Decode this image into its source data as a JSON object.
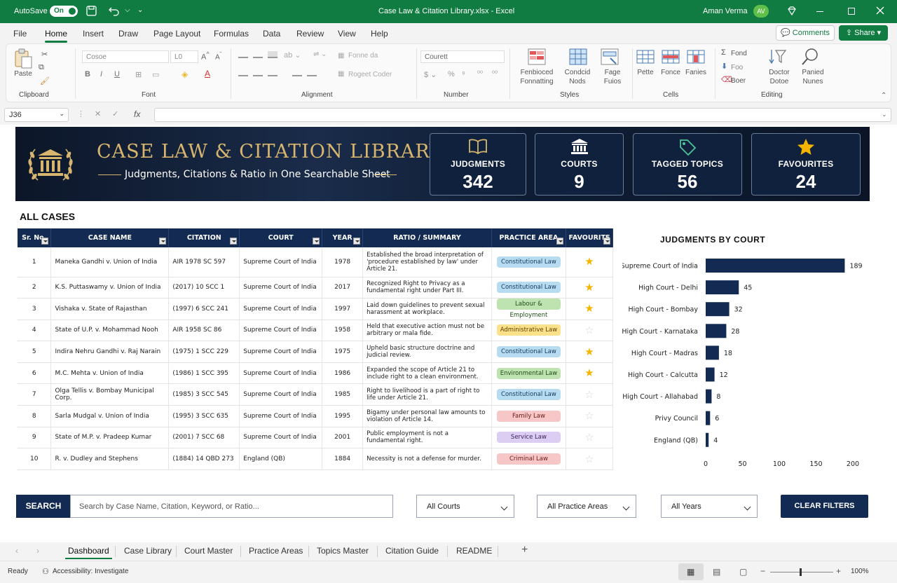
{
  "titlebar": {
    "autosave_label": "AutoSave",
    "autosave_state": "On",
    "document_title": "Case Law & Citation Library.xlsx - Excel",
    "user_name": "Aman Verma",
    "user_initials": "AV"
  },
  "menu": {
    "items": [
      "File",
      "Home",
      "Insert",
      "Draw",
      "Page Layout",
      "Formulas",
      "Data",
      "Review",
      "View",
      "Help"
    ],
    "active": "Home",
    "comments_label": "Comments",
    "share_label": "Share"
  },
  "ribbon": {
    "clipboard": {
      "paste": "Paste",
      "label": "Clipboard"
    },
    "font": {
      "name": "Cosoe",
      "size": "L0",
      "label": "Font"
    },
    "alignment": {
      "wrap": "Fonne da",
      "merge": "Rogeet Coder",
      "label": "Alignment"
    },
    "number": {
      "format": "Courett",
      "label": "Number"
    },
    "styles": {
      "conditional": "Fenbioced Fonnatting",
      "table": "Condcid Nods",
      "cell": "Fage Fuios",
      "label": "Styles"
    },
    "cells": {
      "insert": "Pette",
      "delete": "Fonce",
      "format": "Fanies",
      "label": "Cells"
    },
    "editing": {
      "sum": "Fond",
      "fill": "Foo",
      "clear": "Boer",
      "sort": "Doctor Dotoe",
      "find": "Panied Nunes",
      "label": "Editing"
    }
  },
  "formula_bar": {
    "cell_ref": "J36",
    "fx": "fx",
    "value": ""
  },
  "banner": {
    "title": "CASE LAW & CITATION LIBRARY",
    "subtitle": "Judgments, Citations & Ratio in One Searchable Sheet",
    "stats": [
      {
        "label": "JUDGMENTS",
        "value": "342",
        "icon": "book-icon"
      },
      {
        "label": "COURTS",
        "value": "9",
        "icon": "courthouse-icon"
      },
      {
        "label": "TAGGED TOPICS",
        "value": "56",
        "icon": "tag-icon"
      },
      {
        "label": "FAVOURITES",
        "value": "24",
        "icon": "star-icon"
      }
    ]
  },
  "section_title": "ALL CASES",
  "table": {
    "headers": [
      "Sr. No.",
      "CASE NAME",
      "CITATION",
      "COURT",
      "YEAR",
      "RATIO / SUMMARY",
      "PRACTICE AREA",
      "FAVOURITE"
    ],
    "rows": [
      {
        "sr": "1",
        "name": "Maneka Gandhi v. Union of India",
        "citation": "AIR 1978 SC 597",
        "court": "Supreme Court of India",
        "year": "1978",
        "summary": "Established the broad interpretation of 'procedure established by law' under Article 21.",
        "area": "Constitutional Law",
        "fav": true
      },
      {
        "sr": "2",
        "name": "K.S. Puttaswamy v. Union of India",
        "citation": "(2017) 10 SCC 1",
        "court": "Supreme Court of India",
        "year": "2017",
        "summary": "Recognized Right to Privacy as a fundamental right under Part III.",
        "area": "Constitutional Law",
        "fav": true
      },
      {
        "sr": "3",
        "name": "Vishaka v. State of Rajasthan",
        "citation": "(1997) 6 SCC 241",
        "court": "Supreme Court of India",
        "year": "1997",
        "summary": "Laid down guidelines to prevent sexual harassment at workplace.",
        "area": "Labour & Employment",
        "fav": true
      },
      {
        "sr": "4",
        "name": "State of U.P. v. Mohammad Nooh",
        "citation": "AIR 1958 SC 86",
        "court": "Supreme Court of India",
        "year": "1958",
        "summary": "Held that executive action must not be arbitrary or mala fide.",
        "area": "Administrative Law",
        "fav": false
      },
      {
        "sr": "5",
        "name": "Indira Nehru Gandhi v. Raj Narain",
        "citation": "(1975) 1 SCC 229",
        "court": "Supreme Court of India",
        "year": "1975",
        "summary": "Upheld basic structure doctrine and judicial review.",
        "area": "Constitutional Law",
        "fav": true
      },
      {
        "sr": "6",
        "name": "M.C. Mehta v. Union of India",
        "citation": "(1986) 1 SCC 395",
        "court": "Supreme Court of India",
        "year": "1986",
        "summary": "Expanded the scope of Article 21 to include right to a clean environment.",
        "area": "Environmental Law",
        "fav": true
      },
      {
        "sr": "7",
        "name": "Olga Tellis v. Bombay Municipal Corp.",
        "citation": "(1985) 3 SCC 545",
        "court": "Supreme Court of India",
        "year": "1985",
        "summary": "Right to livelihood is a part of right to life under Article 21.",
        "area": "Constitutional Law",
        "fav": false
      },
      {
        "sr": "8",
        "name": "Sarla Mudgal v. Union of India",
        "citation": "(1995) 3 SCC 635",
        "court": "Supreme Court of India",
        "year": "1995",
        "summary": "Bigamy under personal law amounts to violation of Article 14.",
        "area": "Family Law",
        "fav": false
      },
      {
        "sr": "9",
        "name": "State of M.P. v. Pradeep Kumar",
        "citation": "(2001) 7 SCC 68",
        "court": "Supreme Court of India",
        "year": "2001",
        "summary": "Public employment is not a fundamental right.",
        "area": "Service Law",
        "fav": false
      },
      {
        "sr": "10",
        "name": "R. v. Dudley and Stephens",
        "citation": "(1884) 14 QBD 273",
        "court": "England (QB)",
        "year": "1884",
        "summary": "Necessity is not a defense for murder.",
        "area": "Criminal Law",
        "fav": false
      }
    ],
    "area_colors": {
      "Constitutional Law": {
        "bg": "#b7dcf2",
        "fg": "#123a5a"
      },
      "Labour & Employment": {
        "bg": "#bfe3b0",
        "fg": "#1d4d16"
      },
      "Administrative Law": {
        "bg": "#fde08a",
        "fg": "#5a4300"
      },
      "Environmental Law": {
        "bg": "#bfe3b0",
        "fg": "#1d4d16"
      },
      "Family Law": {
        "bg": "#f7c6c6",
        "fg": "#6b1a1a"
      },
      "Service Law": {
        "bg": "#dccdf2",
        "fg": "#3c2260"
      },
      "Criminal Law": {
        "bg": "#f7c6c6",
        "fg": "#6b1a1a"
      }
    }
  },
  "chart_data": {
    "type": "bar",
    "orientation": "horizontal",
    "title": "JUDGMENTS BY COURT",
    "categories": [
      "Supreme Court of India",
      "High Court - Delhi",
      "High Court - Bombay",
      "High Court - Karnataka",
      "High Court - Madras",
      "High Court - Calcutta",
      "High Court - Allahabad",
      "Privy Council",
      "England (QB)"
    ],
    "values": [
      189,
      45,
      32,
      28,
      18,
      12,
      8,
      6,
      4
    ],
    "xlim": [
      0,
      200
    ],
    "xticks": [
      "0",
      "50",
      "100",
      "150",
      "200"
    ],
    "bar_color": "#132b52",
    "grid": false
  },
  "filters": {
    "search_label": "SEARCH",
    "search_placeholder": "Search by Case Name, Citation, Keyword, or Ratio...",
    "courts": "All Courts",
    "areas": "All Practice Areas",
    "years": "All Years",
    "clear_label": "CLEAR FILTERS"
  },
  "sheet_tabs": {
    "items": [
      "Dashboard",
      "Case Library",
      "Court Master",
      "Practice Areas",
      "Topics Master",
      "Citation Guide",
      "README"
    ],
    "active": "Dashboard",
    "add": "+"
  },
  "status": {
    "ready": "Ready",
    "accessibility": "Accessibility: Investigate",
    "zoom": "100%"
  },
  "colors": {
    "excel_green": "#107c41",
    "navy": "#132b52",
    "gold": "#d7b56e",
    "star": "#f5b400"
  }
}
